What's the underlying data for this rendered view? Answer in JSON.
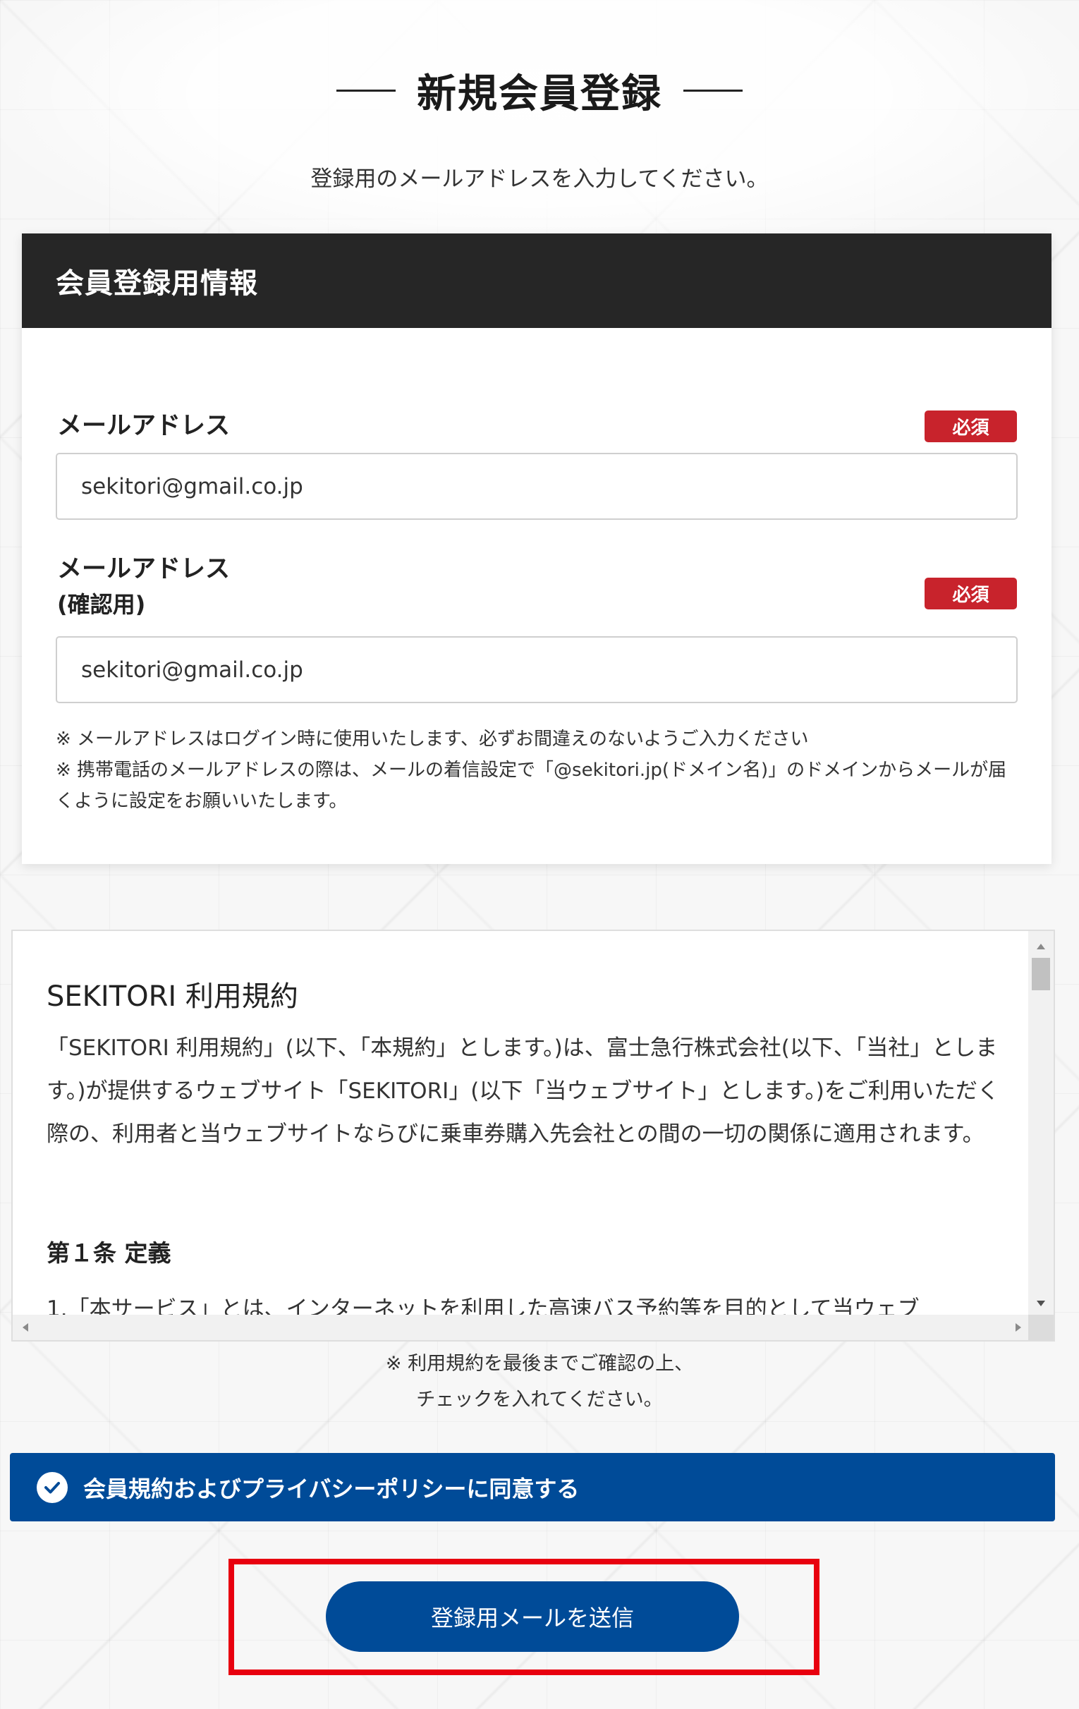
{
  "page": {
    "title": "新規会員登録",
    "subtitle": "登録用のメールアドレスを入力してください。"
  },
  "form": {
    "header": "会員登録用情報",
    "required_label": "必須",
    "email": {
      "label": "メールアドレス",
      "value": "sekitori@gmail.co.jp"
    },
    "email_confirm": {
      "label_line1": "メールアドレス",
      "label_line2": "(確認用)",
      "value": "sekitori@gmail.co.jp"
    },
    "notes": [
      "※ メールアドレスはログイン時に使用いたします、必ずお間違えのないようご入力ください",
      "※ 携帯電話のメールアドレスの際は、メールの着信設定で「@sekitori.jp(ドメイン名)」のドメインからメールが届くように設定をお願いいたします。"
    ]
  },
  "terms": {
    "title": "SEKITORI 利用規約",
    "intro": "「SEKITORI 利用規約」(以下、「本規約」とします。)は、富士急行株式会社(以下、「当社」とします。)が提供するウェブサイト「SEKITORI」(以下「当ウェブサイト」とします。)をご利用いただく際の、利用者と当ウェブサイトならびに乗車券購入先会社との間の一切の関係に適用されます。",
    "article1": "第１条 定義",
    "article1_text": "1.「本サービス」とは、インターネットを利用した高速バス予約等を目的として当ウェブ",
    "note_line1": "※ 利用規約を最後までご確認の上、",
    "note_line2": "チェックを入れてください。"
  },
  "agree": {
    "label": "会員規約およびプライバシーポリシーに同意する",
    "checked": true
  },
  "submit": {
    "label": "登録用メールを送信"
  },
  "colors": {
    "brand_blue": "#004b98",
    "required_red": "#c8232c",
    "highlight_red": "#e8000f",
    "header_dark": "#262626"
  }
}
